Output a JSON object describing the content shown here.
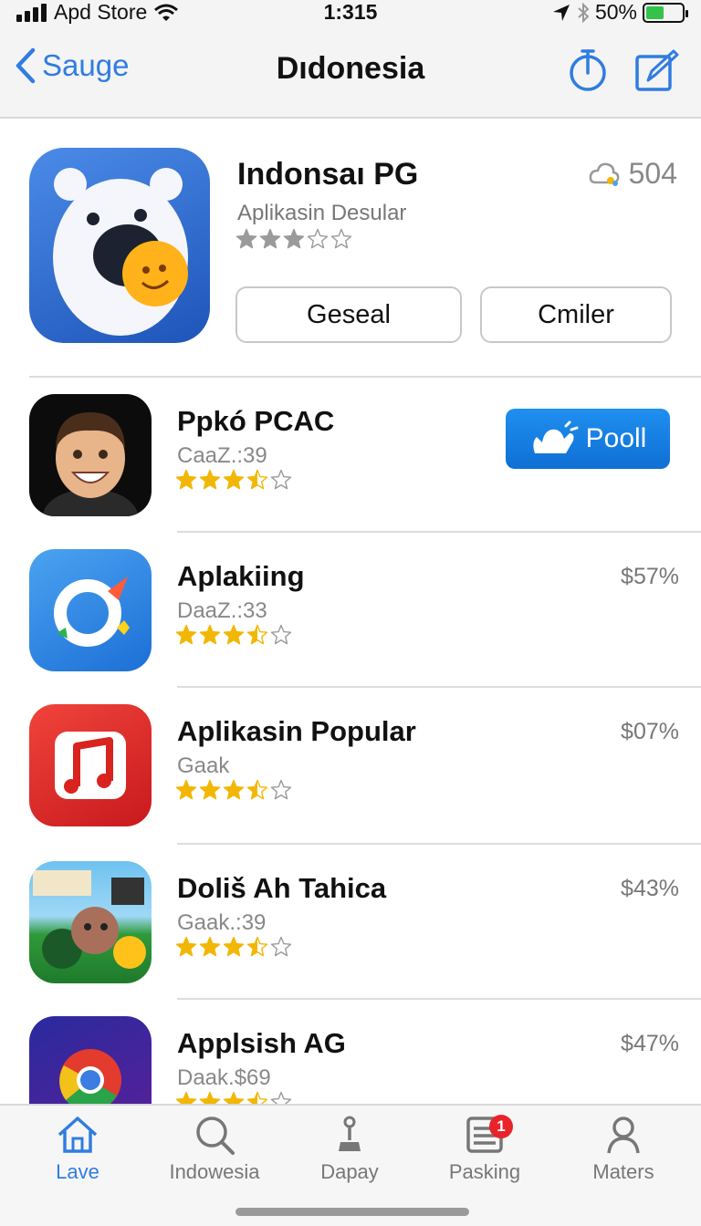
{
  "status_bar": {
    "carrier": "Apd Store",
    "time": "1:315",
    "battery_percent": "50%",
    "battery_level": 0.5
  },
  "nav": {
    "back_label": "Sauge",
    "title": "Dıdonesia"
  },
  "featured": {
    "title": "Indonsaı PG",
    "subtitle": "Aplikasin Desular",
    "rating": 3,
    "count": "504",
    "button_left": "Geseal",
    "button_right": "Cmiler"
  },
  "apps": [
    {
      "name": "Ppkó PCAC",
      "meta": "CaaZ.:39",
      "rating": 3.5,
      "action": "Pooll"
    },
    {
      "name": "Aplakiing",
      "meta": "DaaZ.:33",
      "rating": 3.5,
      "price": "$57%"
    },
    {
      "name": "Aplikasin Popular",
      "meta": "Gaak",
      "rating": 3.5,
      "price": "$07%"
    },
    {
      "name": "Doliš Ah Tahica",
      "meta": "Gaak.:39",
      "rating": 3.5,
      "price": "$43%"
    },
    {
      "name": "Applsish AG",
      "meta": "Daak.$69",
      "rating": 3.5,
      "price": "$47%"
    }
  ],
  "tabs": [
    {
      "label": "Lave",
      "icon": "house-icon",
      "active": true
    },
    {
      "label": "Indowesia",
      "icon": "search-icon"
    },
    {
      "label": "Dapay",
      "icon": "joystick-icon"
    },
    {
      "label": "Pasking",
      "icon": "list-icon",
      "badge": "1"
    },
    {
      "label": "Maters",
      "icon": "person-icon"
    }
  ],
  "colors": {
    "accent": "#2f7de0",
    "star_filled": "#f2b705",
    "star_gray": "#9a9a9a",
    "badge": "#e8242a"
  }
}
